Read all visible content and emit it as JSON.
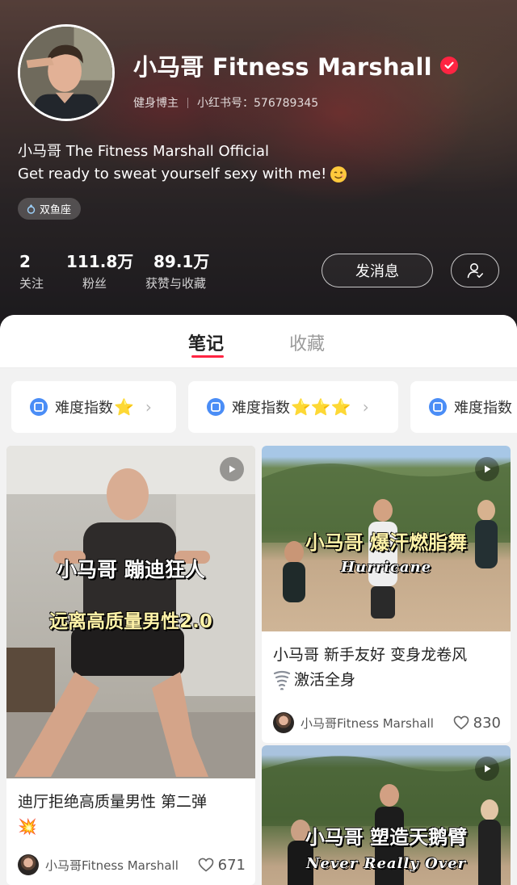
{
  "profile": {
    "name": "小马哥 Fitness Marshall",
    "category": "健身博主",
    "id_label": "小红书号：576789345",
    "bio_line1": "小马哥 The Fitness Marshall Official",
    "bio_line2": "Get ready to sweat yourself sexy with me!",
    "bio_emoji": "wink-emoji-icon",
    "tag": "双鱼座"
  },
  "stats": [
    {
      "value": "2",
      "label": "关注"
    },
    {
      "value": "111.8万",
      "label": "粉丝"
    },
    {
      "value": "89.1万",
      "label": "获赞与收藏"
    }
  ],
  "actions": {
    "message_label": "发消息",
    "follow_icon": "user-check-icon"
  },
  "tabs": [
    {
      "label": "笔记",
      "active": true
    },
    {
      "label": "收藏",
      "active": false
    }
  ],
  "collections": [
    {
      "label": "难度指数",
      "stars": "⭐"
    },
    {
      "label": "难度指数",
      "stars": "⭐⭐⭐"
    },
    {
      "label": "难度指数",
      "stars": ""
    }
  ],
  "notes": [
    {
      "overlay1": "小马哥 蹦迪狂人",
      "overlay2": "远离高质量男性2.0",
      "title_line1": "迪厅拒绝高质量男性 第二弹",
      "title_emoji": "💥",
      "author": "小马哥Fitness Marshall",
      "likes": "671"
    },
    {
      "overlay1": "小马哥 爆汗燃脂舞",
      "overlay2": "Hurricane",
      "title_line1": "小马哥 新手友好 变身龙卷风",
      "title_line2": "激活全身",
      "author": "小马哥Fitness Marshall",
      "likes": "830"
    },
    {
      "overlay1": "小马哥 塑造天鹅臂",
      "overlay2": "Never Really Over"
    }
  ],
  "colors": {
    "brand_red": "#ff2442",
    "star_yellow": "#f5b301"
  }
}
